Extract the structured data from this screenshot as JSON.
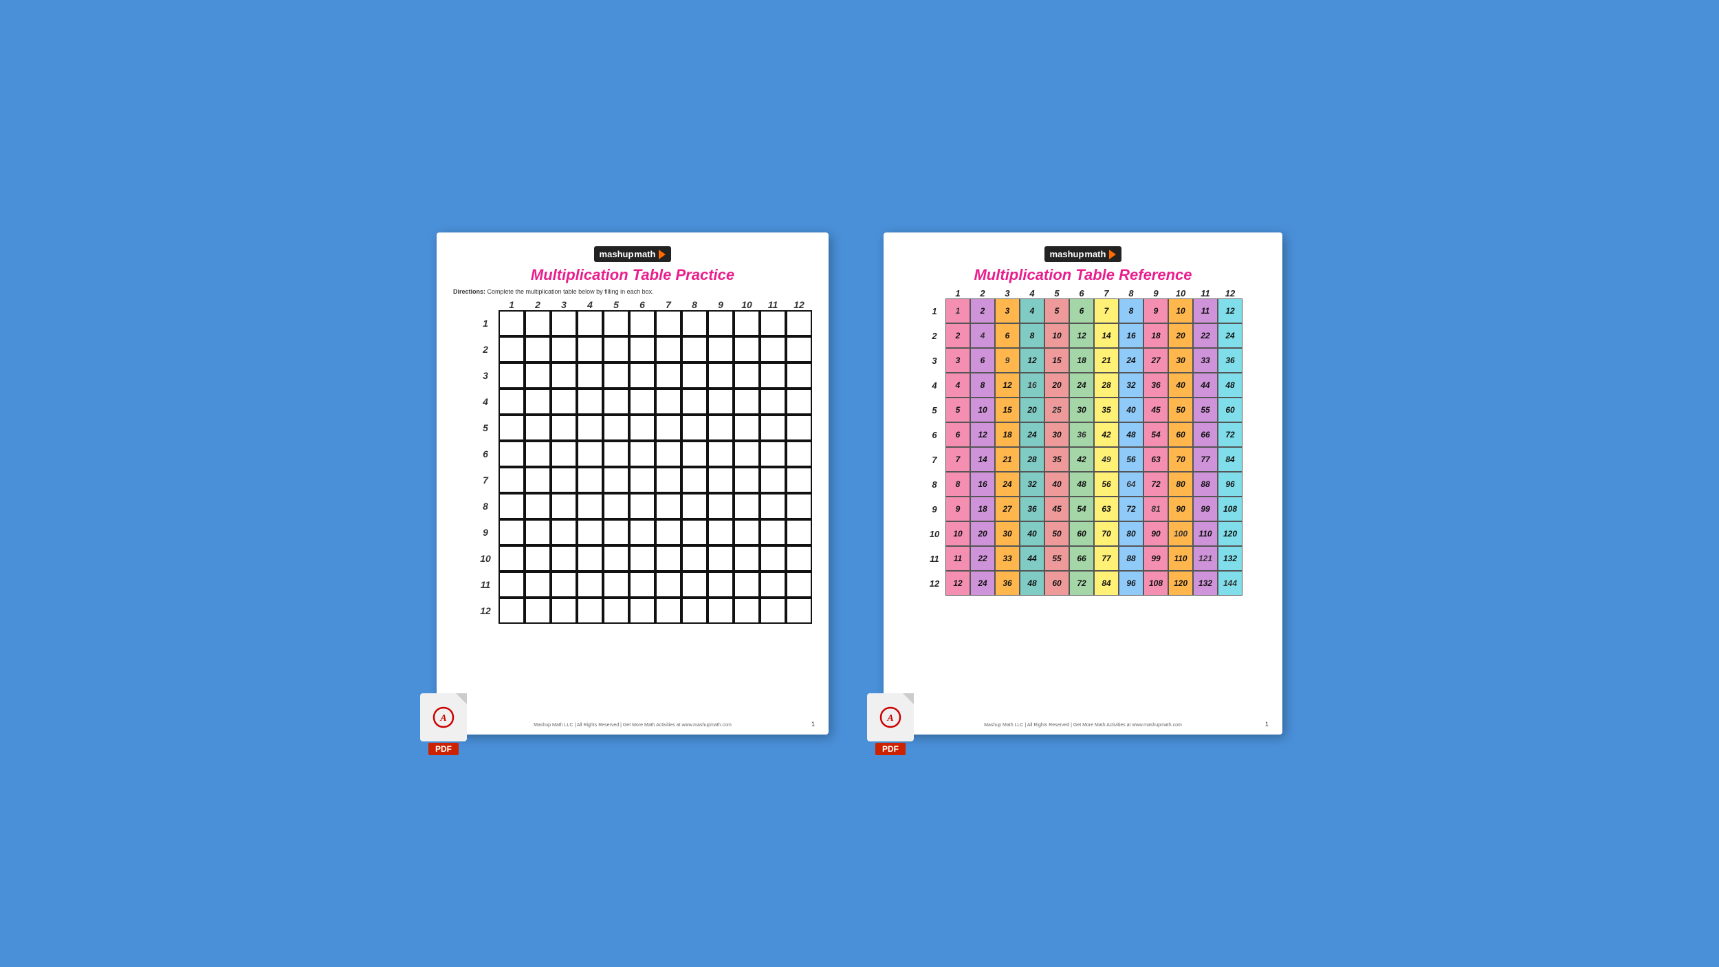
{
  "background": "#4a90d9",
  "practice": {
    "logo_text": "mashupmath",
    "title": "Multiplication Table Practice",
    "directions_bold": "Directions:",
    "directions_text": " Complete the multiplication table below by filling in each box.",
    "col_headers": [
      "1",
      "2",
      "3",
      "4",
      "5",
      "6",
      "7",
      "8",
      "9",
      "10",
      "11",
      "12"
    ],
    "row_headers": [
      "1",
      "2",
      "3",
      "4",
      "5",
      "6",
      "7",
      "8",
      "9",
      "10",
      "11",
      "12"
    ],
    "footer": "Mashup Math LLC | All Rights Reserved | Get More Math Activities at www.mashupmath.com",
    "page_num": "1"
  },
  "reference": {
    "logo_text": "mashupmath",
    "title": "Multiplication Table Reference",
    "col_headers": [
      "1",
      "2",
      "3",
      "4",
      "5",
      "6",
      "7",
      "8",
      "9",
      "10",
      "11",
      "12"
    ],
    "row_headers": [
      "1",
      "2",
      "3",
      "4",
      "5",
      "6",
      "7",
      "8",
      "9",
      "10",
      "11",
      "12"
    ],
    "footer": "Mashup Math LLC | All Rights Reserved | Get More Math Activities at www.mashupmath.com",
    "page_num": "1",
    "table": [
      [
        1,
        2,
        3,
        4,
        5,
        6,
        7,
        8,
        9,
        10,
        11,
        12
      ],
      [
        2,
        4,
        6,
        8,
        10,
        12,
        14,
        16,
        18,
        20,
        22,
        24
      ],
      [
        3,
        6,
        9,
        12,
        15,
        18,
        21,
        24,
        27,
        30,
        33,
        36
      ],
      [
        4,
        8,
        12,
        16,
        20,
        24,
        28,
        32,
        36,
        40,
        44,
        48
      ],
      [
        5,
        10,
        15,
        20,
        25,
        30,
        35,
        40,
        45,
        50,
        55,
        60
      ],
      [
        6,
        12,
        18,
        24,
        30,
        36,
        42,
        48,
        54,
        60,
        66,
        72
      ],
      [
        7,
        14,
        21,
        28,
        35,
        42,
        49,
        56,
        63,
        70,
        77,
        84
      ],
      [
        8,
        16,
        24,
        32,
        40,
        48,
        56,
        64,
        72,
        80,
        88,
        96
      ],
      [
        9,
        18,
        27,
        36,
        45,
        54,
        63,
        72,
        81,
        90,
        99,
        108
      ],
      [
        10,
        20,
        30,
        40,
        50,
        60,
        70,
        80,
        90,
        100,
        110,
        120
      ],
      [
        11,
        22,
        33,
        44,
        55,
        66,
        77,
        88,
        99,
        110,
        121,
        132
      ],
      [
        12,
        24,
        36,
        48,
        60,
        72,
        84,
        96,
        108,
        120,
        132,
        144
      ]
    ]
  }
}
